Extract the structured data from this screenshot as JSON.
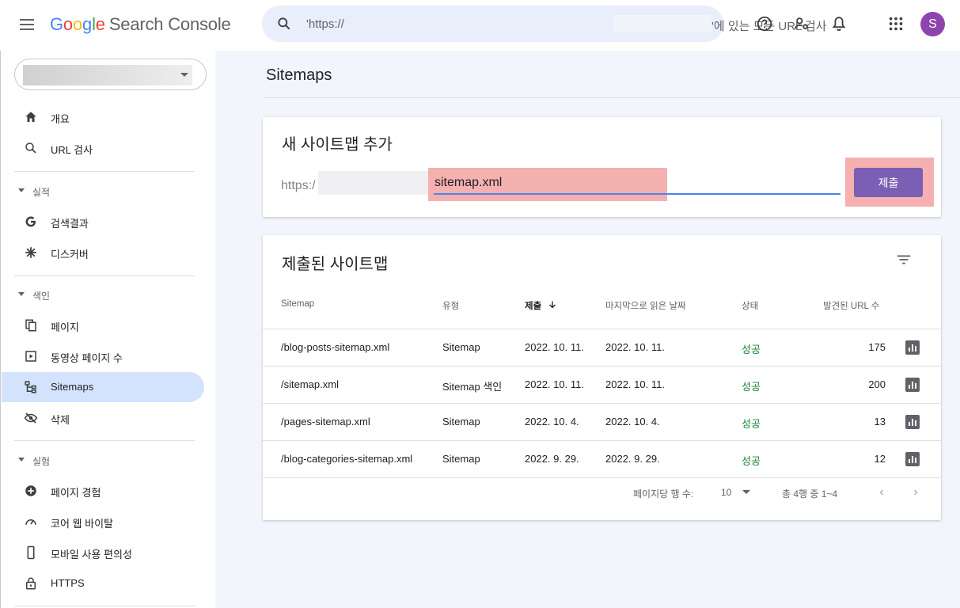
{
  "header": {
    "logo": {
      "g1": "G",
      "g2": "o",
      "g3": "o",
      "g4": "g",
      "g5": "l",
      "g6": "e",
      "rest": "Search Console"
    },
    "search": {
      "prefix": "'https://",
      "suffix": "'에 있는 모든 URL 검사"
    },
    "avatar_letter": "S",
    "icons": [
      "help-icon",
      "manage-users-icon",
      "notifications-icon",
      "apps-icon"
    ]
  },
  "sidebar": {
    "items": [
      {
        "label": "개요",
        "icon": "home-icon"
      },
      {
        "label": "URL 검사",
        "icon": "search-icon"
      }
    ],
    "sections": [
      {
        "label": "실적",
        "items": [
          {
            "label": "검색결과",
            "icon": "google-g-icon"
          },
          {
            "label": "디스커버",
            "icon": "asterisk-icon"
          }
        ]
      },
      {
        "label": "색인",
        "items": [
          {
            "label": "페이지",
            "icon": "pages-icon"
          },
          {
            "label": "동영상 페이지 수",
            "icon": "video-page-icon"
          },
          {
            "label": "Sitemaps",
            "icon": "sitemap-icon"
          },
          {
            "label": "삭제",
            "icon": "removals-icon"
          }
        ]
      },
      {
        "label": "실험",
        "items": [
          {
            "label": "페이지 경험",
            "icon": "plus-circle-icon"
          },
          {
            "label": "코어 웹 바이탈",
            "icon": "gauge-icon"
          },
          {
            "label": "모바일 사용 편의성",
            "icon": "mobile-icon"
          },
          {
            "label": "HTTPS",
            "icon": "lock-icon"
          }
        ]
      }
    ]
  },
  "main": {
    "title": "Sitemaps",
    "add_card": {
      "title": "새 사이트맵 추가",
      "prefix": "https:/",
      "input_value": "sitemap.xml",
      "submit_label": "제출"
    },
    "submitted_card": {
      "title": "제출된 사이트맵",
      "columns": [
        "Sitemap",
        "유형",
        "제출",
        "마지막으로 읽은 날짜",
        "상태",
        "발견된 URL 수"
      ],
      "rows": [
        {
          "sitemap": "/blog-posts-sitemap.xml",
          "type": "Sitemap",
          "submitted": "2022. 10. 11.",
          "last_read": "2022. 10. 11.",
          "status": "성공",
          "urls": "175"
        },
        {
          "sitemap": "/sitemap.xml",
          "type": "Sitemap 색인",
          "submitted": "2022. 10. 11.",
          "last_read": "2022. 10. 11.",
          "status": "성공",
          "urls": "200"
        },
        {
          "sitemap": "/pages-sitemap.xml",
          "type": "Sitemap",
          "submitted": "2022. 10. 4.",
          "last_read": "2022. 10. 4.",
          "status": "성공",
          "urls": "13"
        },
        {
          "sitemap": "/blog-categories-sitemap.xml",
          "type": "Sitemap",
          "submitted": "2022. 9. 29.",
          "last_read": "2022. 9. 29.",
          "status": "성공",
          "urls": "12"
        }
      ],
      "pager": {
        "rows_per_page_label": "페이지당 행 수:",
        "rows_per_page": "10",
        "range": "총 4행 중 1~4"
      }
    }
  },
  "colors": {
    "accent": "#7b5fb4",
    "highlight": "#f5b0b0",
    "status_ok": "#188038",
    "active_nav": "#d3e3fd"
  }
}
